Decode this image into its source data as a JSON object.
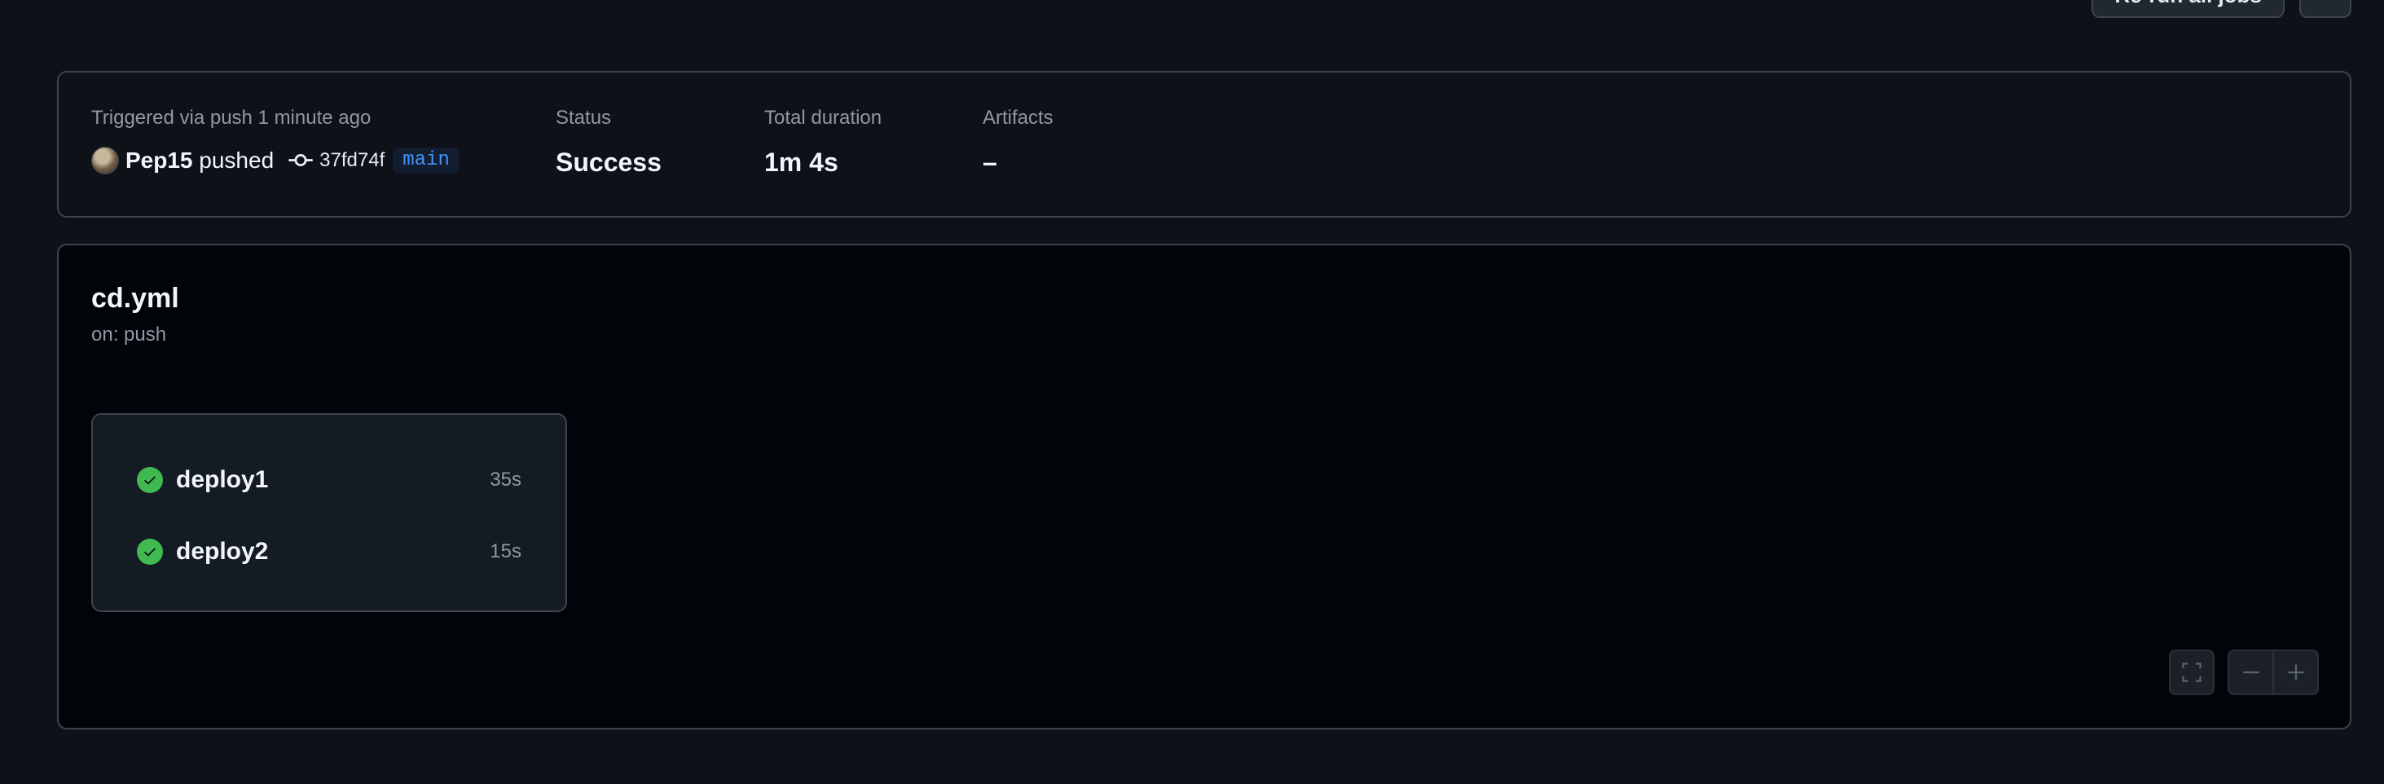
{
  "top_actions": {
    "rerun_label": "Re-run all jobs",
    "more_label": "…"
  },
  "summary": {
    "trigger_label": "Triggered via push 1 minute ago",
    "actor_name": "Pep15",
    "action": "pushed",
    "commit_sha": "37fd74f",
    "branch": "main",
    "status_label": "Status",
    "status_value": "Success",
    "duration_label": "Total duration",
    "duration_value": "1m 4s",
    "artifacts_label": "Artifacts",
    "artifacts_value": "–"
  },
  "workflow": {
    "file": "cd.yml",
    "trigger": "on: push",
    "jobs": [
      {
        "name": "deploy1",
        "duration": "35s",
        "status": "success"
      },
      {
        "name": "deploy2",
        "duration": "15s",
        "status": "success"
      }
    ]
  },
  "colors": {
    "success": "#3fb950",
    "branch": "#4493f8",
    "background": "#0e1117",
    "border": "#3d444d"
  },
  "icons": {
    "commit": "git-commit-icon",
    "check": "check-circle-icon",
    "fullscreen": "fullscreen-icon",
    "zoom_out": "minus-icon",
    "zoom_in": "plus-icon"
  }
}
